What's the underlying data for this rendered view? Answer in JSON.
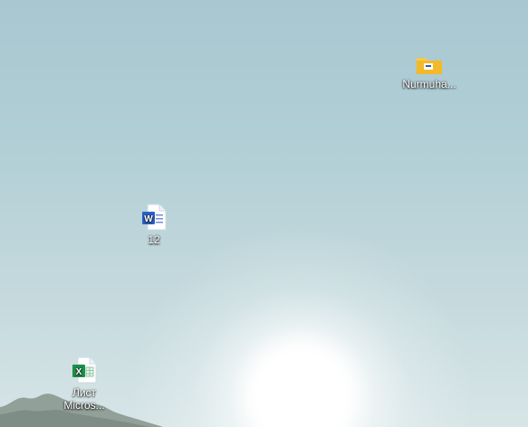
{
  "desktop": {
    "icons": [
      {
        "label": "Nurmuha...",
        "icon": "folder-icon"
      },
      {
        "label": "12",
        "icon": "word-document-icon"
      },
      {
        "label": "Лист Micros...",
        "icon": "excel-document-icon"
      }
    ]
  }
}
